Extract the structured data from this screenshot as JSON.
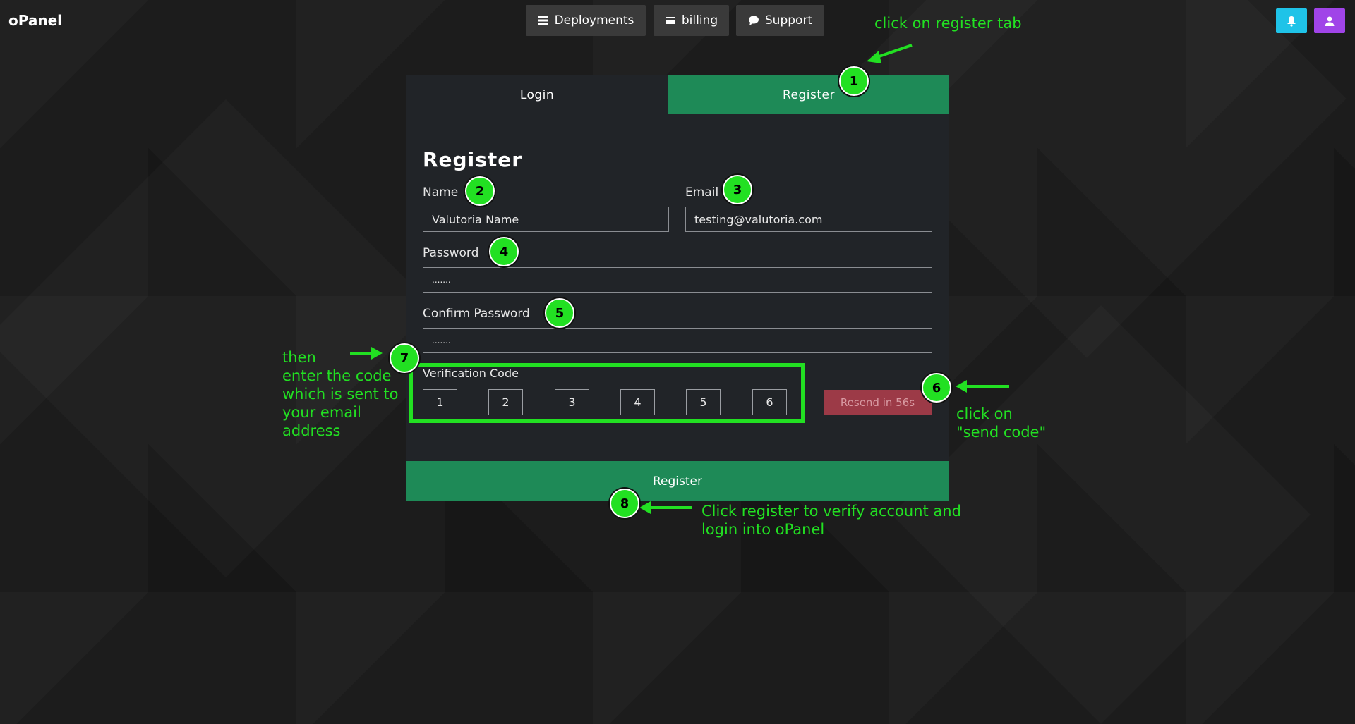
{
  "app": {
    "brand": "oPanel"
  },
  "nav": {
    "deployments": "Deployments",
    "billing": "billing",
    "support": "Support"
  },
  "tabs": {
    "login": "Login",
    "register": "Register"
  },
  "form": {
    "title": "Register",
    "name_label": "Name",
    "name_value": "Valutoria Name",
    "email_label": "Email",
    "email_value": "testing@valutoria.com",
    "password_label": "Password",
    "password_value": ".......",
    "confirm_label": "Confirm Password",
    "confirm_value": ".......",
    "code_label": "Verification Code",
    "code_digits": [
      "1",
      "2",
      "3",
      "4",
      "5",
      "6"
    ],
    "resend_label": "Resend in 56s",
    "submit_label": "Register"
  },
  "annotations": {
    "badges": [
      "1",
      "2",
      "3",
      "4",
      "5",
      "6",
      "7",
      "8"
    ],
    "note1": "click on register tab",
    "note6_line1": "click on",
    "note6_line2": "\"send code\"",
    "note7_line1": "then",
    "note7_line2": "enter the code",
    "note7_line3": "which is sent to",
    "note7_line4": "your email",
    "note7_line5": "address",
    "note8_line1": "Click register to verify account and",
    "note8_line2": "login into oPanel"
  },
  "colors": {
    "accent_green": "#1e8a57",
    "annotation_green": "#22e022",
    "resend_red": "#9c3a47",
    "bell_button": "#1fc3e8",
    "user_button": "#a044e8"
  },
  "icons": [
    "server-icon",
    "credit-card-icon",
    "comment-icon",
    "bell-icon",
    "user-icon"
  ]
}
